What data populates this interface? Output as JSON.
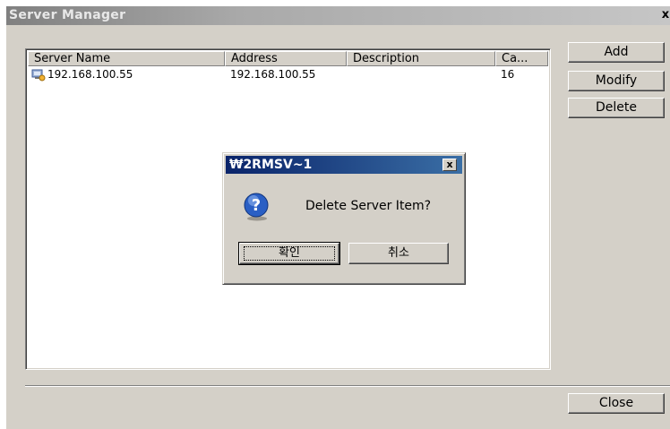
{
  "window": {
    "title": "Server Manager",
    "close_glyph": "x"
  },
  "list": {
    "columns": [
      "Server Name",
      "Address",
      "Description",
      "Ca..."
    ],
    "rows": [
      {
        "server_name": "192.168.100.55",
        "address": "192.168.100.55",
        "description": "",
        "capacity": "16",
        "icon": "server-icon"
      }
    ]
  },
  "buttons": {
    "add": "Add",
    "modify": "Modify",
    "delete": "Delete",
    "close": "Close"
  },
  "dialog": {
    "title": "₩2RMSV~1",
    "close_glyph": "x",
    "message": "Delete Server Item?",
    "icon": "question-icon",
    "ok": "확인",
    "cancel": "취소"
  },
  "colors": {
    "dialog_title_bar": "#0a246a",
    "window_bg": "#d4d0c8"
  }
}
